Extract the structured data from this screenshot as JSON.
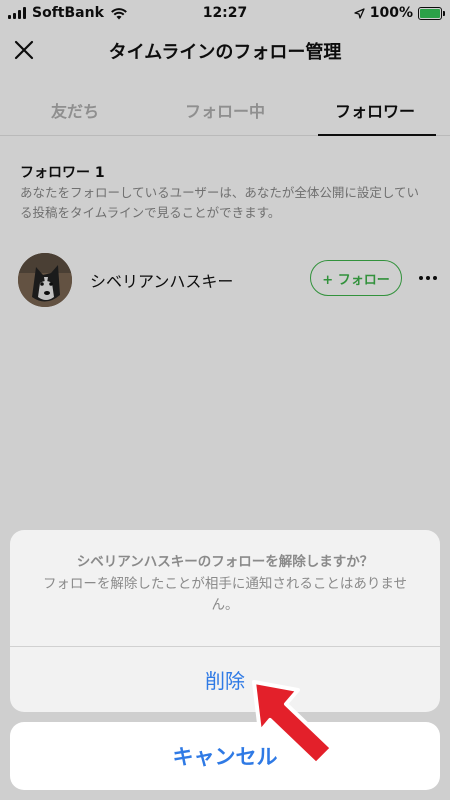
{
  "status_bar": {
    "carrier": "SoftBank",
    "time": "12:27",
    "battery_percent": "100%",
    "battery_level": 1.0,
    "battery_color": "#35c759",
    "icons": [
      "signal-icon",
      "wifi-icon",
      "location-icon",
      "battery-icon"
    ]
  },
  "header": {
    "title": "タイムラインのフォロー管理",
    "close_icon": "close-icon"
  },
  "tabs": [
    {
      "label": "友だち",
      "active": false
    },
    {
      "label": "フォロー中",
      "active": false
    },
    {
      "label": "フォロワー",
      "active": true
    }
  ],
  "followers": {
    "section_title": "フォロワー 1",
    "description": "あなたをフォローしているユーザーは、あなたが全体公開に設定している投稿をタイムラインで見ることができます。",
    "items": [
      {
        "name": "シベリアンハスキー",
        "follow_label": "+ フォロー",
        "more_icon": "more-icon"
      }
    ]
  },
  "action_sheet": {
    "title": "シベリアンハスキーのフォローを解除しますか？",
    "message": "フォローを解除したことが相手に通知されることはありません。",
    "delete_label": "削除",
    "cancel_label": "キャンセル"
  },
  "colors": {
    "accent_green": "#3eb44a",
    "action_blue": "#2f7ae5",
    "annotation_red": "#e3202a"
  }
}
